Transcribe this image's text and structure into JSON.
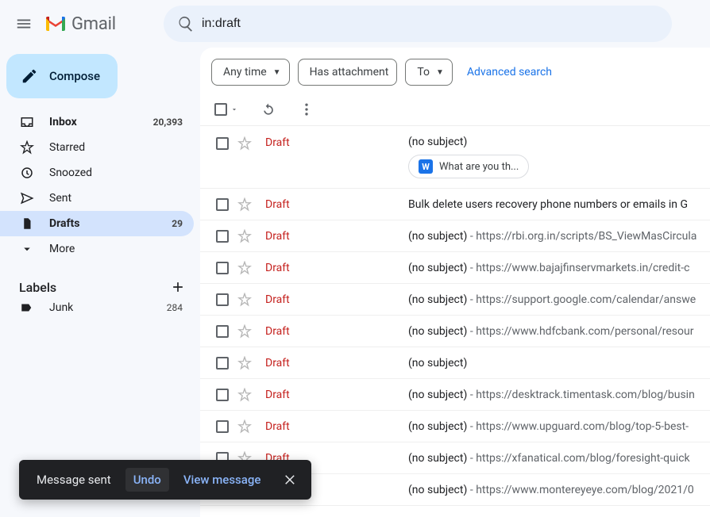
{
  "header": {
    "app_name": "Gmail",
    "search_value": "in:draft"
  },
  "compose_label": "Compose",
  "nav": [
    {
      "icon": "inbox",
      "label": "Inbox",
      "count": "20,393",
      "bold": true
    },
    {
      "icon": "star",
      "label": "Starred"
    },
    {
      "icon": "clock",
      "label": "Snoozed"
    },
    {
      "icon": "send",
      "label": "Sent"
    },
    {
      "icon": "file",
      "label": "Drafts",
      "count": "29",
      "bold": true,
      "active": true
    },
    {
      "icon": "chevron-down",
      "label": "More"
    }
  ],
  "labels_header": "Labels",
  "labels": [
    {
      "icon": "tag",
      "label": "Junk",
      "count": "284"
    }
  ],
  "chips": {
    "anytime": "Any time",
    "has_attachment": "Has attachment",
    "to": "To",
    "advanced": "Advanced search"
  },
  "draft_label": "Draft",
  "rows": [
    {
      "subject": "(no subject)",
      "attachment": "What are you th...",
      "first": true
    },
    {
      "subject": "Bulk delete users recovery phone numbers or emails in G"
    },
    {
      "subject": "(no subject)",
      "body": "https://rbi.org.in/scripts/BS_ViewMasCircula"
    },
    {
      "subject": "(no subject)",
      "body": "https://www.bajajfinservmarkets.in/credit-c"
    },
    {
      "subject": "(no subject)",
      "body": "https://support.google.com/calendar/answe"
    },
    {
      "subject": "(no subject)",
      "body": "https://www.hdfcbank.com/personal/resour"
    },
    {
      "subject": "(no subject)"
    },
    {
      "subject": "(no subject)",
      "body": "https://desktrack.timentask.com/blog/busin"
    },
    {
      "subject": "(no subject)",
      "body": "https://www.upguard.com/blog/top-5-best-"
    },
    {
      "subject": "(no subject)",
      "body": "https://xfanatical.com/blog/foresight-quick"
    },
    {
      "subject": "(no subject)",
      "body": "https://www.montereyeye.com/blog/2021/0"
    }
  ],
  "snackbar": {
    "message": "Message sent",
    "undo": "Undo",
    "view": "View message"
  }
}
